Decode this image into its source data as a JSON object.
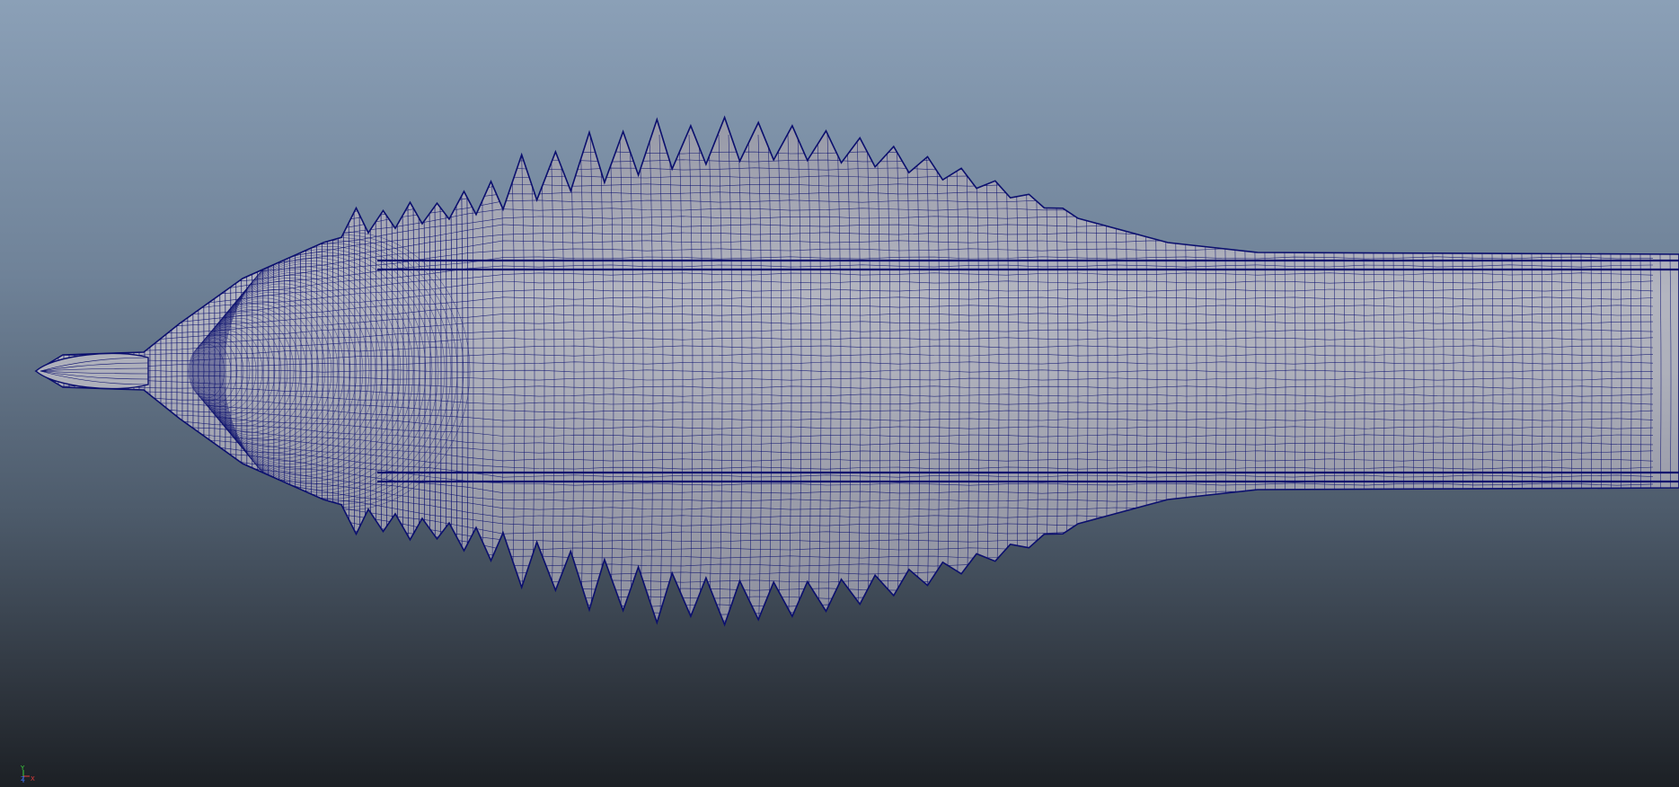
{
  "viewport": {
    "background_top": "#8ba0b7",
    "background_bottom": "#1c2025",
    "wire_color": "#0b0f6e",
    "surface_color": "#a8aab6",
    "surface_shade": "#8f92a0"
  },
  "axis": {
    "x_label": "X",
    "y_label": "Y",
    "z_label": "Z",
    "x_color": "#e23b3b",
    "y_color": "#3bd13b",
    "z_color": "#3b6be2"
  }
}
